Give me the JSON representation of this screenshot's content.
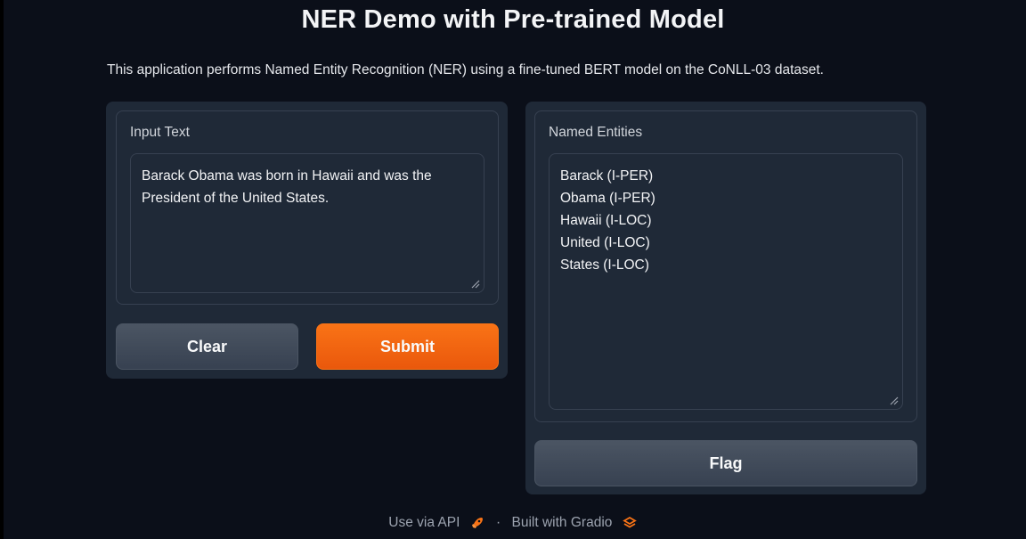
{
  "app": {
    "title": "NER Demo with Pre-trained Model",
    "description": "This application performs Named Entity Recognition (NER) using a fine-tuned BERT model on the CoNLL-03 dataset."
  },
  "input": {
    "label": "Input Text",
    "value_lines": [
      "Barack Obama was born in Hawaii and was the",
      "President of the United States."
    ]
  },
  "buttons": {
    "clear": "Clear",
    "submit": "Submit",
    "flag": "Flag"
  },
  "output": {
    "label": "Named Entities",
    "entities": [
      "Barack (I-PER)",
      "Obama (I-PER)",
      "Hawaii (I-LOC)",
      "United (I-LOC)",
      "States (I-LOC)"
    ]
  },
  "footer": {
    "api_link": "Use via API",
    "separator": "·",
    "built_with": "Built with Gradio"
  },
  "colors": {
    "background": "#0b0f19",
    "panel": "#1f2937",
    "primary": "#f97316",
    "secondary": "#4b5563"
  },
  "icons": {
    "api": "rocket-icon",
    "gradio": "gradio-logo-icon",
    "resize": "resize-handle-icon"
  }
}
